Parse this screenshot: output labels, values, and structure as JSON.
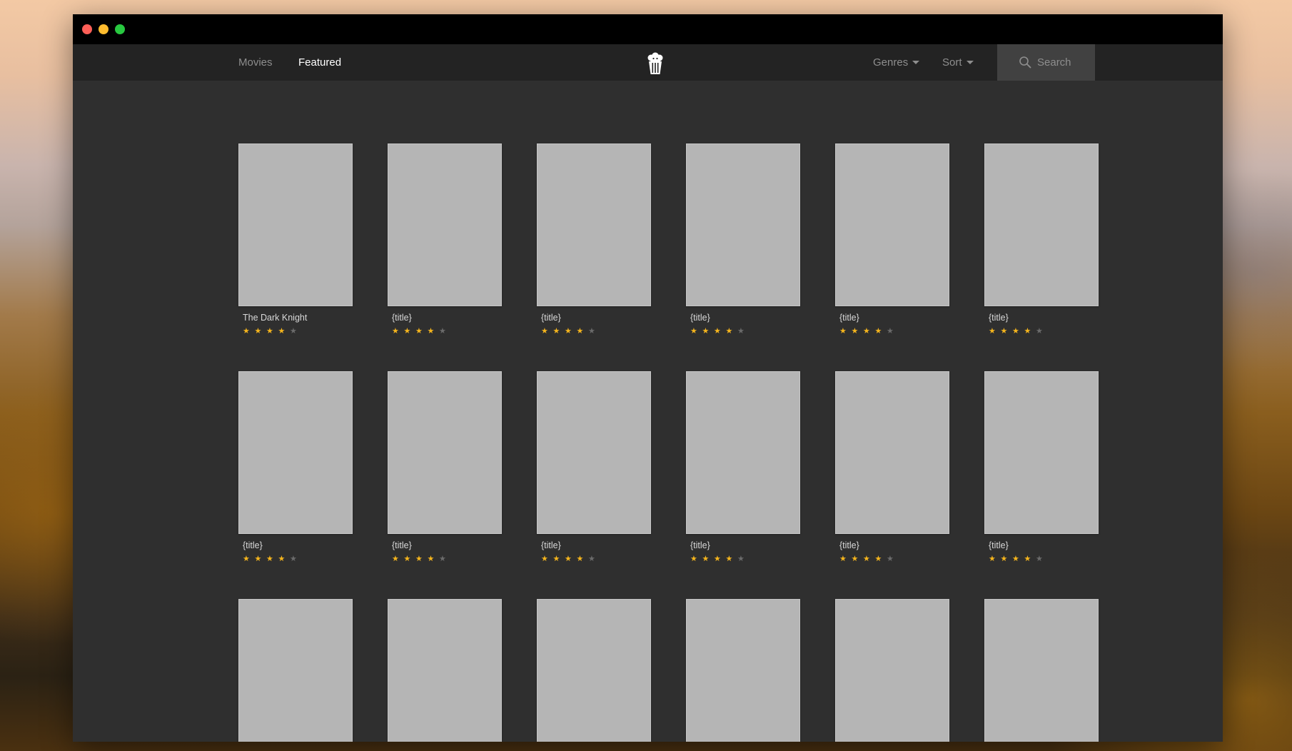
{
  "window": {
    "traffic_lights": [
      "close",
      "minimize",
      "maximize"
    ]
  },
  "nav": {
    "links": [
      {
        "label": "Movies",
        "active": false
      },
      {
        "label": "Featured",
        "active": true
      }
    ],
    "logo_icon": "popcorn-icon",
    "genres_label": "Genres",
    "sort_label": "Sort",
    "search_placeholder": "Search",
    "search_icon": "search-icon"
  },
  "colors": {
    "star_on": "#f5b51d",
    "star_off": "#6b6b6b",
    "poster": "#b5b5b5"
  },
  "movies": [
    {
      "title": "The Dark Knight",
      "rating": 4,
      "max_rating": 5
    },
    {
      "title": "{title}",
      "rating": 4,
      "max_rating": 5
    },
    {
      "title": "{title}",
      "rating": 4,
      "max_rating": 5
    },
    {
      "title": "{title}",
      "rating": 4,
      "max_rating": 5
    },
    {
      "title": "{title}",
      "rating": 4,
      "max_rating": 5
    },
    {
      "title": "{title}",
      "rating": 4,
      "max_rating": 5
    },
    {
      "title": "{title}",
      "rating": 4,
      "max_rating": 5
    },
    {
      "title": "{title}",
      "rating": 4,
      "max_rating": 5
    },
    {
      "title": "{title}",
      "rating": 4,
      "max_rating": 5
    },
    {
      "title": "{title}",
      "rating": 4,
      "max_rating": 5
    },
    {
      "title": "{title}",
      "rating": 4,
      "max_rating": 5
    },
    {
      "title": "{title}",
      "rating": 4,
      "max_rating": 5
    },
    {
      "title": "",
      "rating": null,
      "max_rating": 5
    },
    {
      "title": "",
      "rating": null,
      "max_rating": 5
    },
    {
      "title": "",
      "rating": null,
      "max_rating": 5
    },
    {
      "title": "",
      "rating": null,
      "max_rating": 5
    },
    {
      "title": "",
      "rating": null,
      "max_rating": 5
    },
    {
      "title": "",
      "rating": null,
      "max_rating": 5
    }
  ]
}
